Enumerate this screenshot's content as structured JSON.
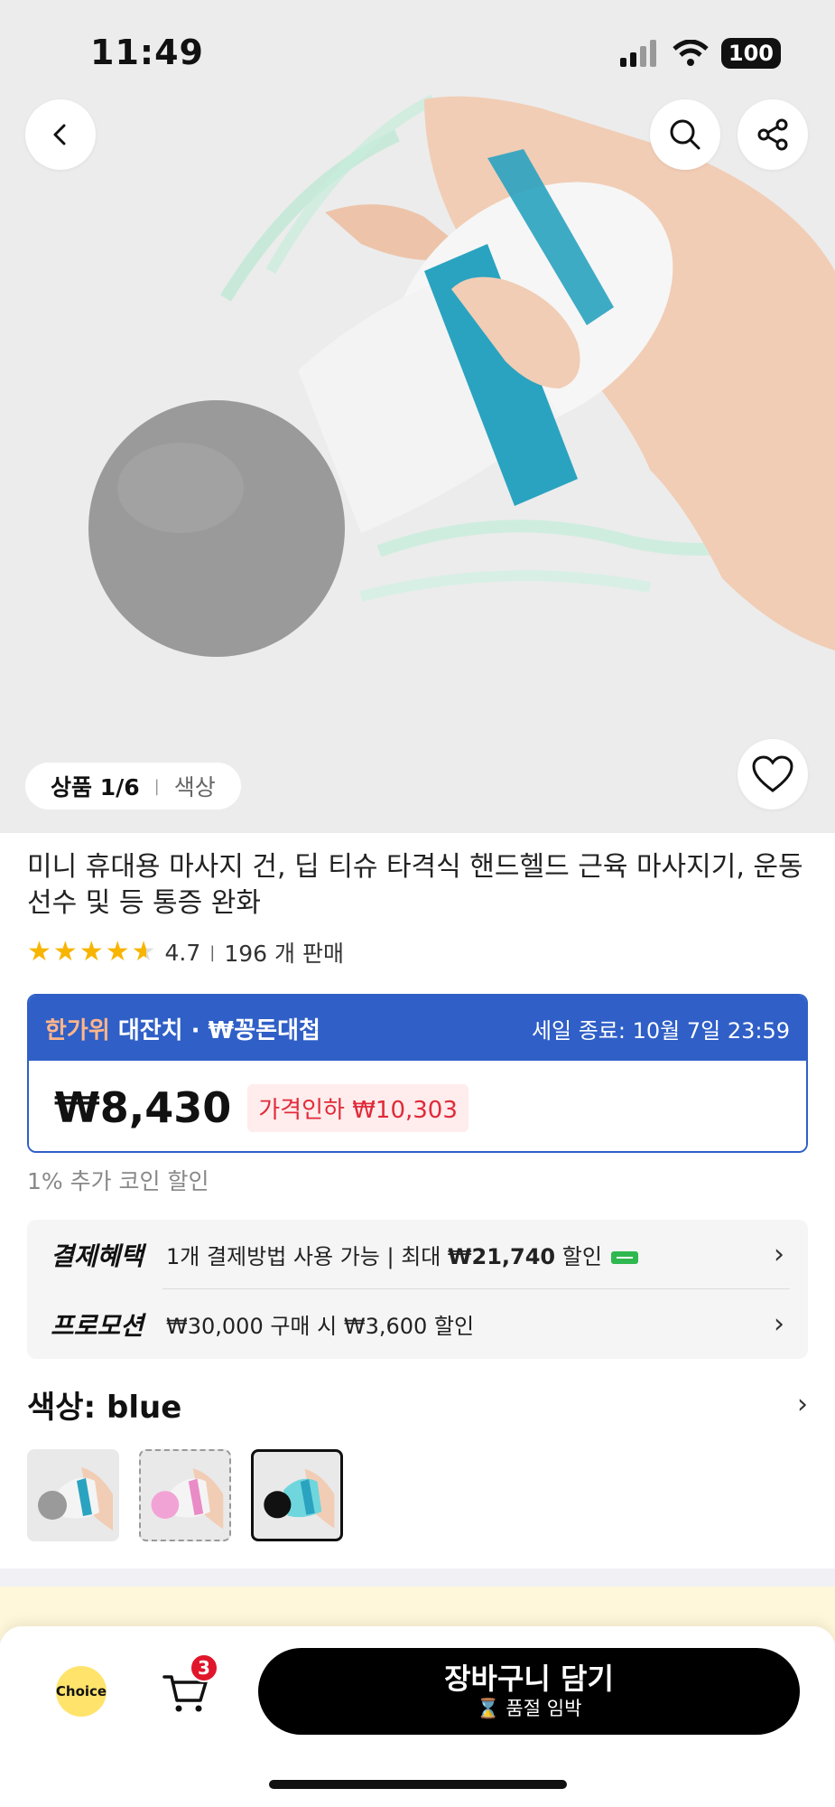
{
  "status_bar": {
    "time": "11:49",
    "battery": "100"
  },
  "gallery": {
    "counter_label": "상품 1/6",
    "color_label": "색상"
  },
  "product": {
    "title": "미니 휴대용 마사지 건, 딥 티슈 타격식 핸드헬드 근육 마사지기, 운동선수 및 등 통증 완화",
    "rating": "4.7",
    "sold": "196 개 판매"
  },
  "sale": {
    "brand_highlight": "한가위",
    "brand_rest": " 대잔치 · ₩꽁돈대첩",
    "end_text": "세일 종료: 10월 7일 23:59",
    "price": "₩8,430",
    "discount_label": "가격인하 ₩10,303"
  },
  "coin_note": "1% 추가 코인 할인",
  "benefits": {
    "payment_label": "결제혜택",
    "payment_pre": "1개 결제방법 사용 가능 | 최대 ",
    "payment_amount": "₩21,740",
    "payment_post": " 할인",
    "promo_label": "프로모션",
    "promo_text": "₩30,000 구매 시 ₩3,600 할인"
  },
  "color_section": {
    "label": "색상: blue",
    "options": [
      "gray",
      "pink",
      "blue"
    ]
  },
  "bottom_bar": {
    "choice_label": "Choice",
    "cart_count": "3",
    "add_to_cart": "장바구니 담기",
    "stock_note": "⌛ 품절 임박"
  },
  "colors": {
    "accent_blue": "#2f5fc7",
    "discount_red": "#e02a3a",
    "choice_yellow": "#ffe36b"
  }
}
